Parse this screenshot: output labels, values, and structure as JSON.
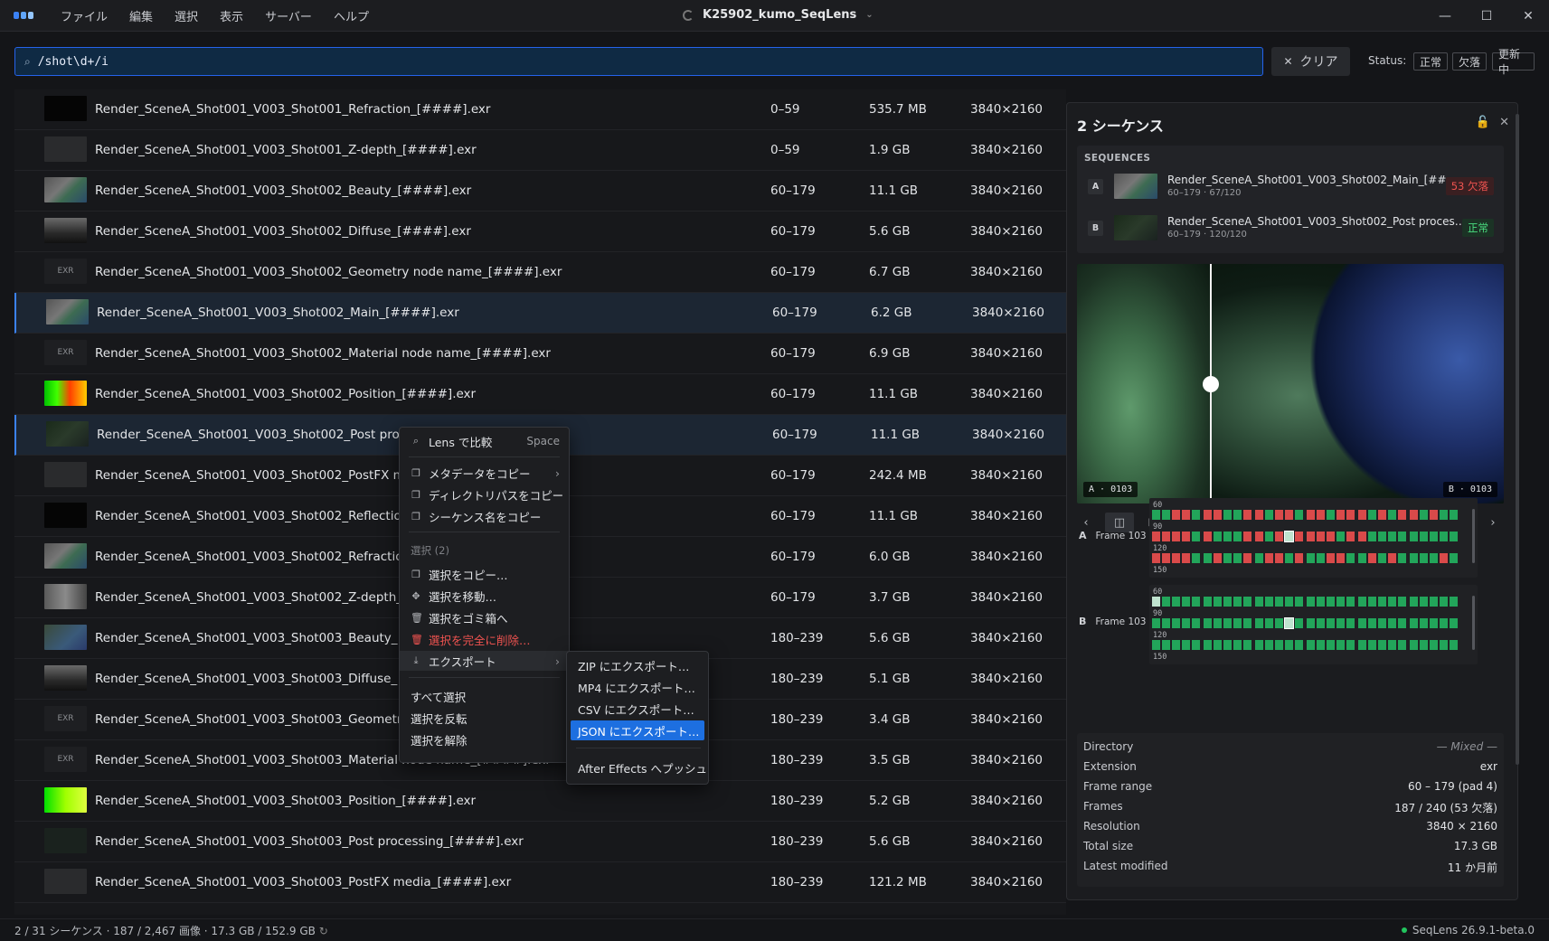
{
  "titlebar": {
    "menu": [
      "ファイル",
      "編集",
      "選択",
      "表示",
      "サーバー",
      "ヘルプ"
    ],
    "title": "K25902_kumo_SeqLens",
    "controls": [
      "—",
      "☐",
      "✕"
    ]
  },
  "search": {
    "value": "/shot\\d+/i",
    "clear_label": "クリア",
    "status_label": "Status:",
    "status_buttons": [
      "正常",
      "欠落",
      "更新中"
    ]
  },
  "rows": [
    {
      "thumb": "black",
      "thumb_text": "",
      "name": "Render_SceneA_Shot001_V003_Shot001_Refraction_[####].exr",
      "range": "0–59",
      "size": "535.7 MB",
      "res": "3840×2160"
    },
    {
      "thumb": "dark",
      "thumb_text": "",
      "name": "Render_SceneA_Shot001_V003_Shot001_Z-depth_[####].exr",
      "range": "0–59",
      "size": "1.9 GB",
      "res": "3840×2160"
    },
    {
      "thumb": "beauty",
      "thumb_text": "",
      "name": "Render_SceneA_Shot001_V003_Shot002_Beauty_[####].exr",
      "range": "60–179",
      "size": "11.1 GB",
      "res": "3840×2160"
    },
    {
      "thumb": "diffuse",
      "thumb_text": "",
      "name": "Render_SceneA_Shot001_V003_Shot002_Diffuse_[####].exr",
      "range": "60–179",
      "size": "5.6 GB",
      "res": "3840×2160"
    },
    {
      "thumb": "exr",
      "thumb_text": "EXR",
      "name": "Render_SceneA_Shot001_V003_Shot002_Geometry node name_[####].exr",
      "range": "60–179",
      "size": "6.7 GB",
      "res": "3840×2160"
    },
    {
      "thumb": "beauty",
      "thumb_text": "",
      "name": "Render_SceneA_Shot001_V003_Shot002_Main_[####].exr",
      "range": "60–179",
      "size": "6.2 GB",
      "res": "3840×2160",
      "selected": true
    },
    {
      "thumb": "exr",
      "thumb_text": "EXR",
      "name": "Render_SceneA_Shot001_V003_Shot002_Material node name_[####].exr",
      "range": "60–179",
      "size": "6.9 GB",
      "res": "3840×2160"
    },
    {
      "thumb": "position",
      "thumb_text": "",
      "name": "Render_SceneA_Shot001_V003_Shot002_Position_[####].exr",
      "range": "60–179",
      "size": "11.1 GB",
      "res": "3840×2160"
    },
    {
      "thumb": "post",
      "thumb_text": "",
      "name": "Render_SceneA_Shot001_V003_Shot002_Post proc",
      "range": "60–179",
      "size": "11.1 GB",
      "res": "3840×2160",
      "selected": true
    },
    {
      "thumb": "dark",
      "thumb_text": "",
      "name": "Render_SceneA_Shot001_V003_Shot002_PostFX m",
      "range": "60–179",
      "size": "242.4 MB",
      "res": "3840×2160"
    },
    {
      "thumb": "black",
      "thumb_text": "",
      "name": "Render_SceneA_Shot001_V003_Shot002_Reflectio",
      "range": "60–179",
      "size": "11.1 GB",
      "res": "3840×2160"
    },
    {
      "thumb": "beauty",
      "thumb_text": "",
      "name": "Render_SceneA_Shot001_V003_Shot002_Refractio",
      "range": "60–179",
      "size": "6.0 GB",
      "res": "3840×2160"
    },
    {
      "thumb": "zdepth",
      "thumb_text": "",
      "name": "Render_SceneA_Shot001_V003_Shot002_Z-depth_",
      "range": "60–179",
      "size": "3.7 GB",
      "res": "3840×2160"
    },
    {
      "thumb": "blue",
      "thumb_text": "",
      "name": "Render_SceneA_Shot001_V003_Shot003_Beauty_",
      "range": "180–239",
      "size": "5.6 GB",
      "res": "3840×2160"
    },
    {
      "thumb": "diffuse",
      "thumb_text": "",
      "name": "Render_SceneA_Shot001_V003_Shot003_Diffuse_",
      "range": "180–239",
      "size": "5.1 GB",
      "res": "3840×2160"
    },
    {
      "thumb": "exr",
      "thumb_text": "EXR",
      "name": "Render_SceneA_Shot001_V003_Shot003_Geometr",
      "range": "180–239",
      "size": "3.4 GB",
      "res": "3840×2160"
    },
    {
      "thumb": "exr",
      "thumb_text": "EXR",
      "name": "Render_SceneA_Shot001_V003_Shot003_Material node name_[####].exr",
      "range": "180–239",
      "size": "3.5 GB",
      "res": "3840×2160"
    },
    {
      "thumb": "position2",
      "thumb_text": "",
      "name": "Render_SceneA_Shot001_V003_Shot003_Position_[####].exr",
      "range": "180–239",
      "size": "5.2 GB",
      "res": "3840×2160"
    },
    {
      "thumb": "darkgreen",
      "thumb_text": "",
      "name": "Render_SceneA_Shot001_V003_Shot003_Post processing_[####].exr",
      "range": "180–239",
      "size": "5.6 GB",
      "res": "3840×2160"
    },
    {
      "thumb": "dark",
      "thumb_text": "",
      "name": "Render_SceneA_Shot001_V003_Shot003_PostFX media_[####].exr",
      "range": "180–239",
      "size": "121.2 MB",
      "res": "3840×2160"
    }
  ],
  "context_menu": {
    "compare": {
      "label": "Lens で比較",
      "shortcut": "Space"
    },
    "copy_metadata": "メタデータをコピー",
    "copy_dirpath": "ディレクトリパスをコピー",
    "copy_seqname": "シーケンス名をコピー",
    "selection_section": "選択 (2)",
    "copy_selection": "選択をコピー…",
    "move_selection": "選択を移動…",
    "trash_selection": "選択をゴミ箱へ",
    "delete_selection": "選択を完全に削除…",
    "export": "エクスポート",
    "select_all": "すべて選択",
    "invert_selection": "選択を反転",
    "clear_selection": "選択を解除"
  },
  "export_submenu": [
    "ZIP にエクスポート…",
    "MP4 にエクスポート…",
    "CSV にエクスポート…",
    "JSON にエクスポート…",
    "After Effects へプッシュ"
  ],
  "panel": {
    "title": "2 シーケンス",
    "sequences_header": "SEQUENCES",
    "sequences": [
      {
        "letter": "A",
        "name": "Render_SceneA_Shot001_V003_Shot002_Main_[##…",
        "meta": "60–179 · 67/120",
        "badge": "53 欠落",
        "badge_kind": "red"
      },
      {
        "letter": "B",
        "name": "Render_SceneA_Shot001_V003_Shot002_Post proces…",
        "meta": "60–179 · 120/120",
        "badge": "正常",
        "badge_kind": "green"
      }
    ],
    "preview_label_a": "A · 0103",
    "preview_label_b": "B · 0103",
    "frame_a": {
      "letter": "A",
      "label": "Frame 103",
      "rows": [
        "60",
        "90",
        "120",
        "150"
      ],
      "current_frame": 103
    },
    "frame_b": {
      "letter": "B",
      "label": "Frame 103",
      "rows": [
        "60",
        "90",
        "120",
        "150"
      ],
      "current_frame": 103
    },
    "details": [
      {
        "k": "Directory",
        "v": "— Mixed —"
      },
      {
        "k": "Extension",
        "v": "exr"
      },
      {
        "k": "Frame range",
        "v": "60 – 179 (pad 4)"
      },
      {
        "k": "Frames",
        "v": "187 / 240 (53 欠落)"
      },
      {
        "k": "Resolution",
        "v": "3840 × 2160"
      },
      {
        "k": "Total size",
        "v": "17.3 GB"
      },
      {
        "k": "Latest modified",
        "v": "11 か月前"
      }
    ]
  },
  "statusbar": {
    "left": "2 / 31 シーケンス · 187 / 2,467 画像 · 17.3 GB / 152.9 GB",
    "version": "SeqLens 26.9.1-beta.0"
  },
  "colors": {
    "accent": "#3b82f6",
    "ok": "#22a55a",
    "missing": "#d94a4a"
  }
}
